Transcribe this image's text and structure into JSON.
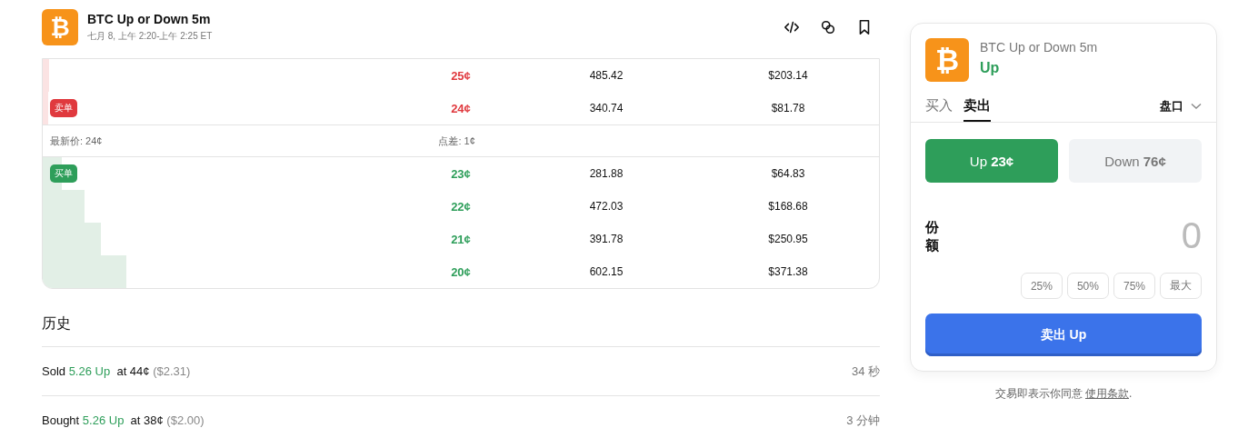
{
  "header": {
    "logo_glyph": "₿",
    "title": "BTC Up or Down 5m",
    "subtitle": "七月 8, 上午 2:20-上午 2:25 ET"
  },
  "orderbook": {
    "asks": [
      {
        "price": "25¢",
        "shares": "485.42",
        "total": "$203.14",
        "level": 0.008
      },
      {
        "price": "24¢",
        "shares": "340.74",
        "total": "$81.78",
        "level": 0.007,
        "badge": "卖单"
      }
    ],
    "last_price": "最新价: 24¢",
    "spread": "点差: 1¢",
    "bids": [
      {
        "price": "23¢",
        "shares": "281.88",
        "total": "$64.83",
        "level": 0.023,
        "badge": "买单"
      },
      {
        "price": "22¢",
        "shares": "472.03",
        "total": "$168.68",
        "level": 0.05
      },
      {
        "price": "21¢",
        "shares": "391.78",
        "total": "$250.95",
        "level": 0.07
      },
      {
        "price": "20¢",
        "shares": "602.15",
        "total": "$371.38",
        "level": 0.1
      }
    ]
  },
  "history": {
    "title": "历史",
    "items": [
      {
        "verb": "Sold",
        "amount": "5.26 Up",
        "price": "at 44¢",
        "value": "($2.31)",
        "time": "34 秒"
      },
      {
        "verb": "Bought",
        "amount": "5.26 Up",
        "price": "at 38¢",
        "value": "($2.00)",
        "time": "3 分钟"
      }
    ]
  },
  "trade": {
    "logo_glyph": "₿",
    "market": "BTC Up or Down 5m",
    "outcome": "Up",
    "tabs": [
      {
        "label": "买入",
        "selected": false
      },
      {
        "label": "卖出",
        "selected": true
      }
    ],
    "order_type": "盘口",
    "outcomes": [
      {
        "label": "Up",
        "price": "23¢",
        "selected": true
      },
      {
        "label": "Down",
        "price": "76¢",
        "selected": false
      }
    ],
    "shares_label": "份额",
    "shares_placeholder": "0",
    "presets": [
      "25%",
      "50%",
      "75%",
      "最大"
    ],
    "submit": "卖出 Up",
    "terms": "交易即表示你同意",
    "terms_link": "使用条款",
    "terms_end": "."
  }
}
